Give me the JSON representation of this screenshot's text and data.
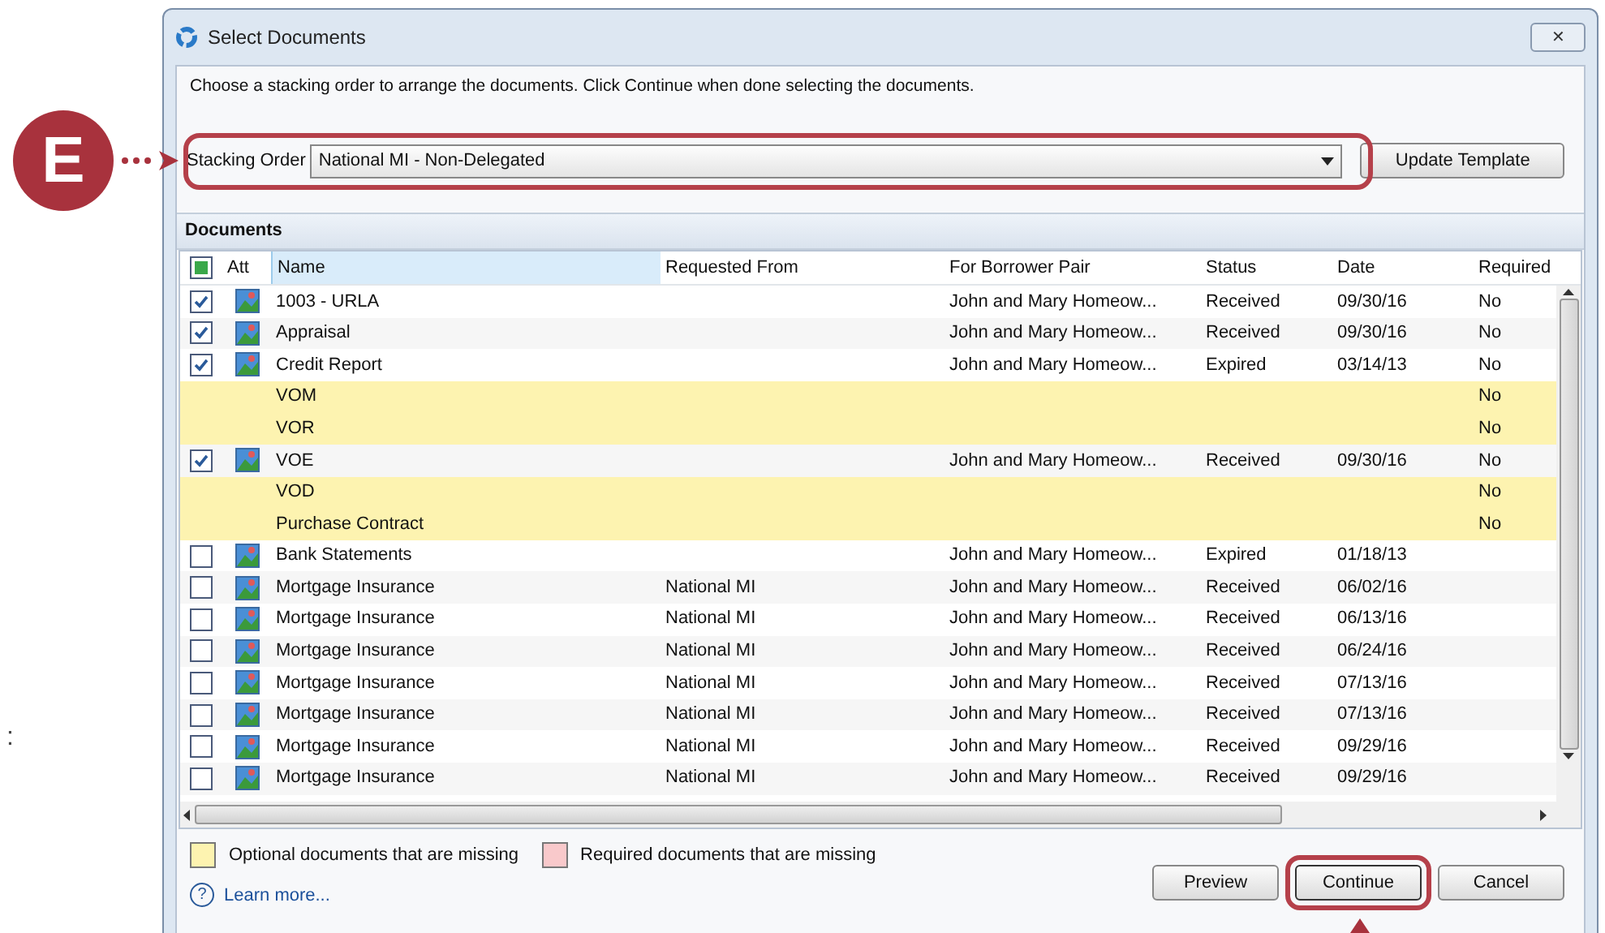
{
  "callout": {
    "label": "E"
  },
  "edge_text": ":",
  "window": {
    "title": "Select Documents",
    "close": "✕"
  },
  "instruction": "Choose a stacking order to arrange the documents. Click Continue when done selecting the documents.",
  "stacking_order": {
    "label": "Stacking Order",
    "value": "National MI - Non-Delegated",
    "button": "Update Template"
  },
  "documents": {
    "title": "Documents",
    "select_all_mixed": true,
    "columns": [
      "Att",
      "Name",
      "Requested From",
      "For Borrower Pair",
      "Status",
      "Date",
      "Required"
    ],
    "rows": [
      {
        "kind": "document",
        "checked": true,
        "name": "1003 - URLA",
        "from": "",
        "pair": "John and Mary Homeow...",
        "status": "Received",
        "date": "09/30/16",
        "required": "No"
      },
      {
        "kind": "document",
        "checked": true,
        "name": "Appraisal",
        "from": "",
        "pair": "John and Mary Homeow...",
        "status": "Received",
        "date": "09/30/16",
        "required": "No"
      },
      {
        "kind": "document",
        "checked": true,
        "name": "Credit Report",
        "from": "",
        "pair": "John and Mary Homeow...",
        "status": "Expired",
        "date": "03/14/13",
        "required": "No"
      },
      {
        "kind": "missing",
        "name": "VOM",
        "required": "No"
      },
      {
        "kind": "missing",
        "name": "VOR",
        "required": "No"
      },
      {
        "kind": "document",
        "checked": true,
        "name": "VOE",
        "from": "",
        "pair": "John and Mary Homeow...",
        "status": "Received",
        "date": "09/30/16",
        "required": "No"
      },
      {
        "kind": "missing",
        "name": "VOD",
        "required": "No"
      },
      {
        "kind": "missing",
        "name": "Purchase Contract",
        "required": "No"
      },
      {
        "kind": "document",
        "checked": false,
        "name": "Bank Statements",
        "from": "",
        "pair": "John and Mary Homeow...",
        "status": "Expired",
        "date": "01/18/13",
        "required": ""
      },
      {
        "kind": "document",
        "checked": false,
        "name": "Mortgage Insurance",
        "from": "National MI",
        "pair": "John and Mary Homeow...",
        "status": "Received",
        "date": "06/02/16",
        "required": ""
      },
      {
        "kind": "document",
        "checked": false,
        "name": "Mortgage Insurance",
        "from": "National MI",
        "pair": "John and Mary Homeow...",
        "status": "Received",
        "date": "06/13/16",
        "required": ""
      },
      {
        "kind": "document",
        "checked": false,
        "name": "Mortgage Insurance",
        "from": "National MI",
        "pair": "John and Mary Homeow...",
        "status": "Received",
        "date": "06/24/16",
        "required": ""
      },
      {
        "kind": "document",
        "checked": false,
        "name": "Mortgage Insurance",
        "from": "National MI",
        "pair": "John and Mary Homeow...",
        "status": "Received",
        "date": "07/13/16",
        "required": ""
      },
      {
        "kind": "document",
        "checked": false,
        "name": "Mortgage Insurance",
        "from": "National MI",
        "pair": "John and Mary Homeow...",
        "status": "Received",
        "date": "07/13/16",
        "required": ""
      },
      {
        "kind": "document",
        "checked": false,
        "name": "Mortgage Insurance",
        "from": "National MI",
        "pair": "John and Mary Homeow...",
        "status": "Received",
        "date": "09/29/16",
        "required": ""
      },
      {
        "kind": "document",
        "checked": false,
        "name": "Mortgage Insurance",
        "from": "National MI",
        "pair": "John and Mary Homeow...",
        "status": "Received",
        "date": "09/29/16",
        "required": ""
      }
    ]
  },
  "legend": [
    {
      "label": "Optional documents that are missing",
      "color": "#fdf3b0"
    },
    {
      "label": "Required documents that are missing",
      "color": "#f9c9cb"
    }
  ],
  "learn_more": {
    "icon": "?",
    "label": "Learn more..."
  },
  "buttons": [
    {
      "label": "Preview",
      "highlighted": false
    },
    {
      "label": "Continue",
      "highlighted": true
    },
    {
      "label": "Cancel",
      "highlighted": false
    }
  ]
}
